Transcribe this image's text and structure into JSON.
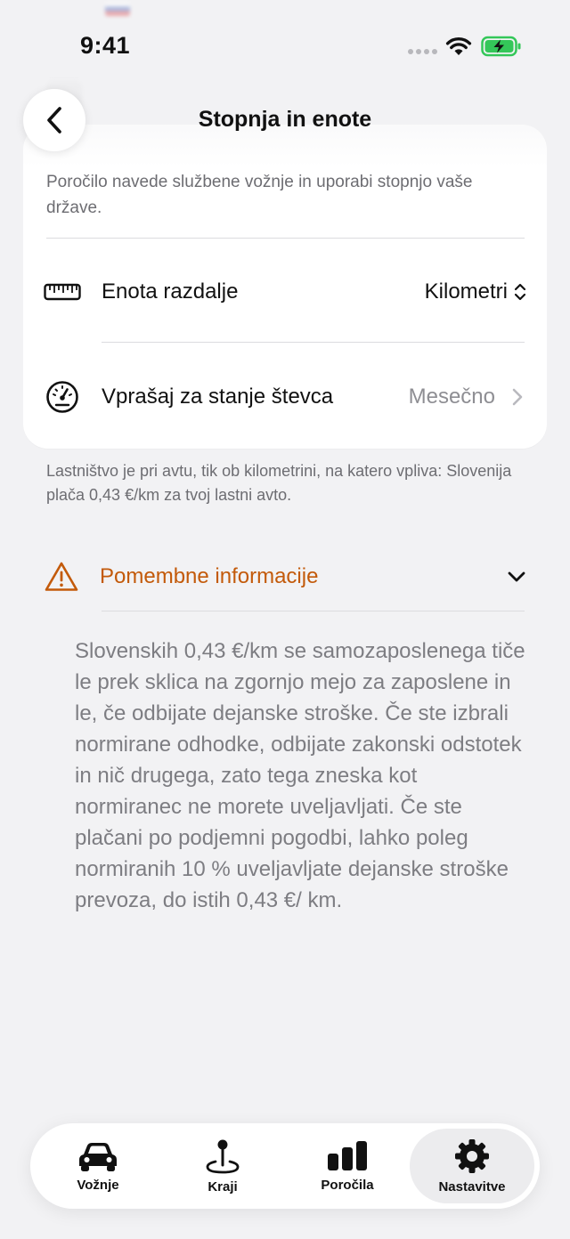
{
  "status_bar": {
    "time": "9:41"
  },
  "nav": {
    "title": "Stopnja in enote"
  },
  "card": {
    "description": "Poročilo navede službene vožnje in uporabi stopnjo vaše države.",
    "rows": [
      {
        "label": "Enota razdalje",
        "value": "Kilometri",
        "icon": "ruler-icon"
      },
      {
        "label": "Vprašaj za stanje števca",
        "value": "Mesečno",
        "icon": "gauge-icon"
      }
    ]
  },
  "footnote": "Lastništvo je pri avtu, tik ob kilometrini, na katero vpliva: Slovenija plača 0,43 €/km za tvoj lastni avto.",
  "info": {
    "title": "Pomembne informacije",
    "body": "Slovenskih 0,43 €/km se samozaposlenega tiče le prek sklica na zgornjo mejo za zaposlene in le, če odbijate dejanske stroške. Če ste izbrali normirane odhodke, odbijate zakonski odstotek in nič drugega, zato tega zneska kot normiranec ne morete uveljavljati. Če ste plačani po podjemni pogodbi, lahko poleg normiranih 10 % uveljavljate dejanske stroške prevoza, do istih 0,43 €/ km.",
    "accent_color": "#c35a0a"
  },
  "tabs": [
    {
      "label": "Vožnje",
      "icon": "car-icon",
      "active": false
    },
    {
      "label": "Kraji",
      "icon": "map-pin-icon",
      "active": false
    },
    {
      "label": "Poročila",
      "icon": "bar-chart-icon",
      "active": false
    },
    {
      "label": "Nastavitve",
      "icon": "gear-icon",
      "active": true
    }
  ]
}
